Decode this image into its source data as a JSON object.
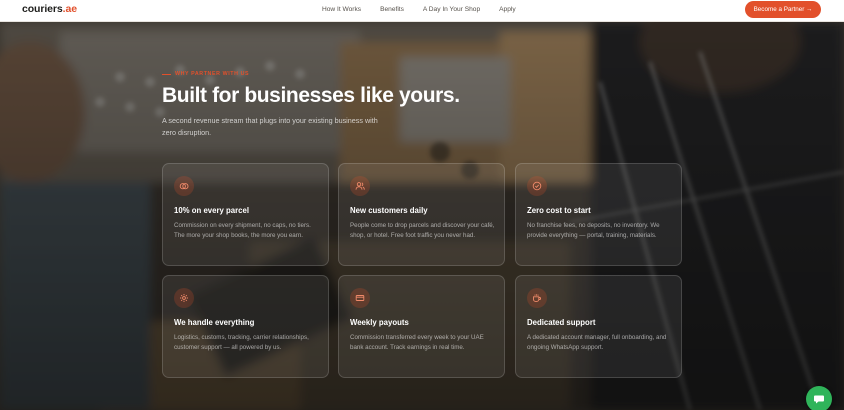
{
  "nav": {
    "logo_main": "couriers",
    "logo_tld": ".ae",
    "links": [
      "How It Works",
      "Benefits",
      "A Day In Your Shop",
      "Apply"
    ],
    "cta": "Become a Partner →"
  },
  "hero": {
    "eyebrow": "Why partner with us",
    "headline": "Built for businesses like yours.",
    "subhead": "A second revenue stream that plugs into your existing business with zero disruption."
  },
  "cards": [
    {
      "icon": "coins-icon",
      "title": "10% on every parcel",
      "desc": "Commission on every shipment, no caps, no tiers. The more your shop books, the more you earn."
    },
    {
      "icon": "users-icon",
      "title": "New customers daily",
      "desc": "People come to drop parcels and discover your café, shop, or hotel. Free foot traffic you never had."
    },
    {
      "icon": "check-circle-icon",
      "title": "Zero cost to start",
      "desc": "No franchise fees, no deposits, no inventory. We provide everything — portal, training, materials."
    },
    {
      "icon": "gear-icon",
      "title": "We handle everything",
      "desc": "Logistics, customs, tracking, carrier relationships, customer support — all powered by us."
    },
    {
      "icon": "credit-card-icon",
      "title": "Weekly payouts",
      "desc": "Commission transferred every week to your UAE bank account. Track earnings in real time."
    },
    {
      "icon": "coffee-cup-icon",
      "title": "Dedicated support",
      "desc": "A dedicated account manager, full onboarding, and ongoing WhatsApp support."
    }
  ],
  "colors": {
    "accent": "#e2502b",
    "chat": "#2fb45a",
    "card_bg": "rgba(255,255,255,0.075)"
  },
  "chat_icon": "chat-bubble-icon"
}
